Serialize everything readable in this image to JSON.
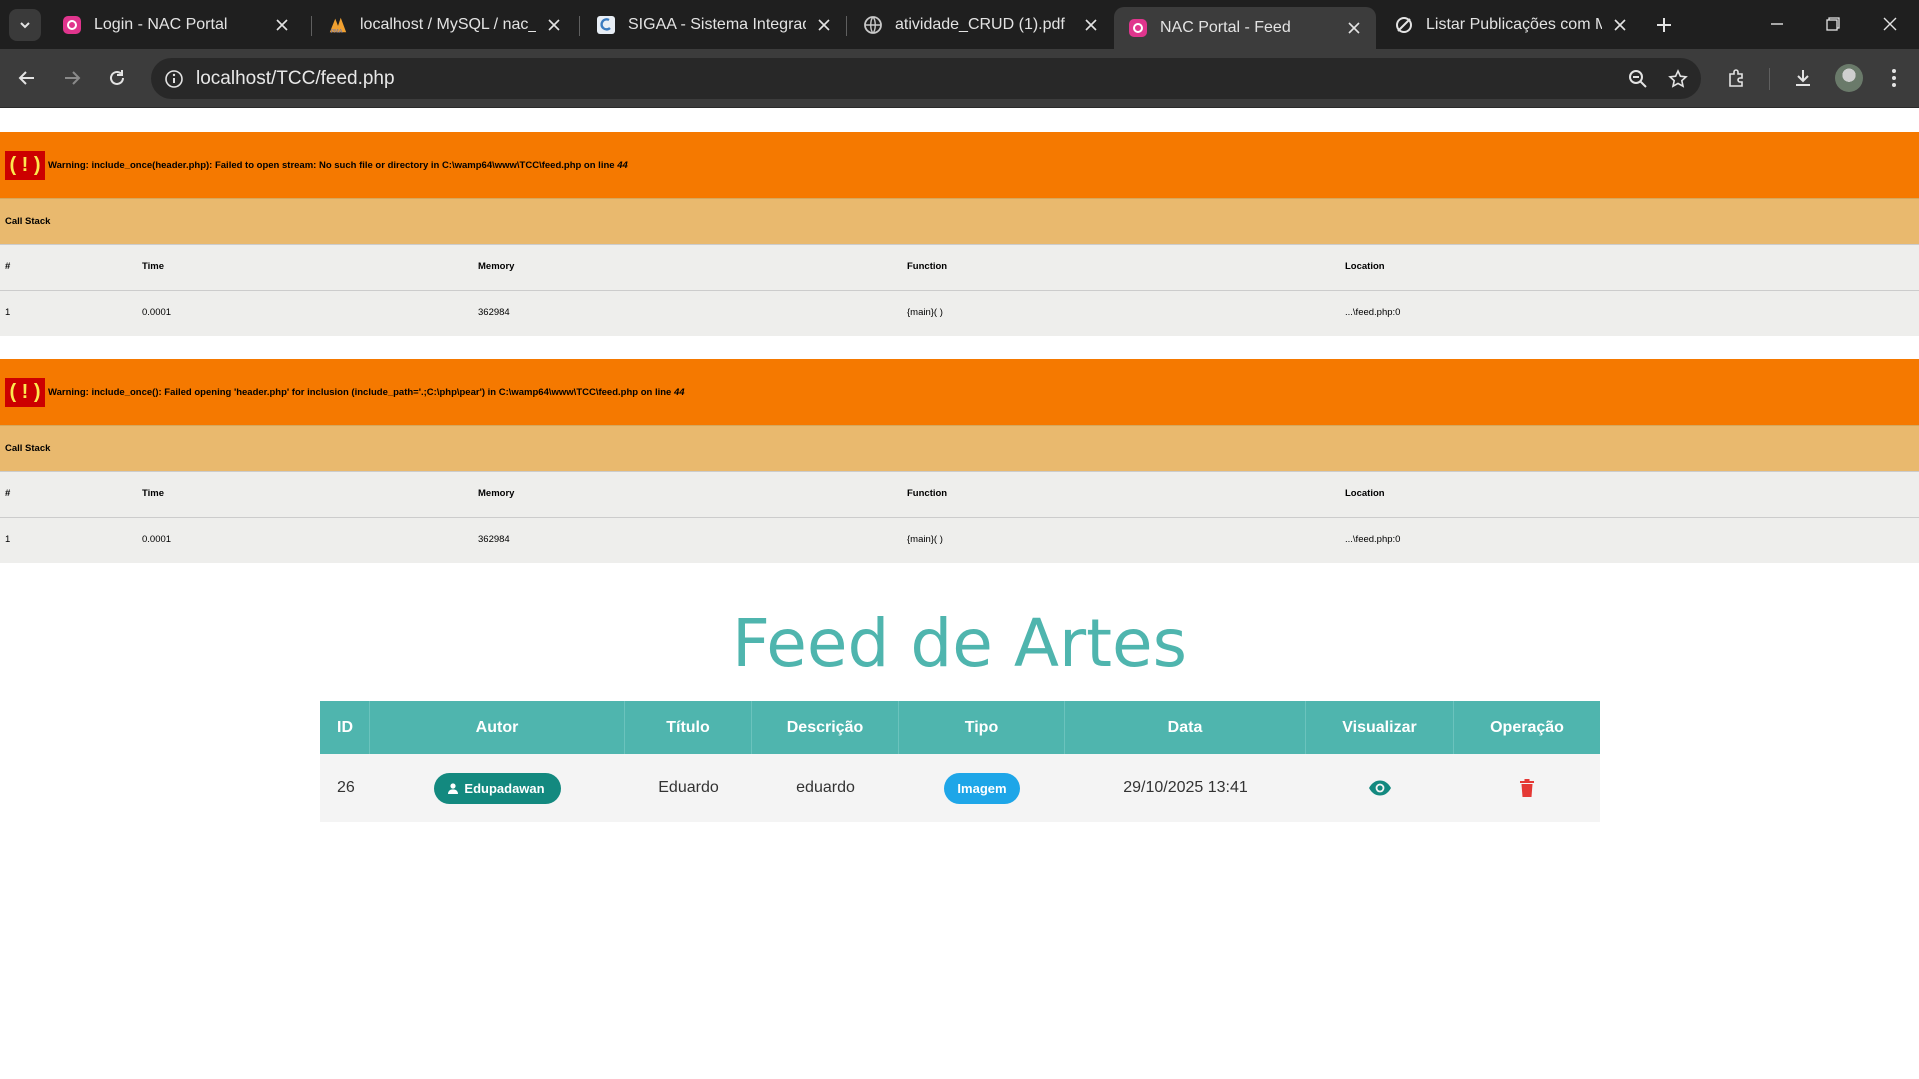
{
  "browser": {
    "tabs": [
      {
        "title": "Login - NAC Portal",
        "active": false
      },
      {
        "title": "localhost / MySQL / nac_p",
        "active": false
      },
      {
        "title": "SIGAA - Sistema Integrado",
        "active": false
      },
      {
        "title": "atividade_CRUD (1).pdf",
        "active": false
      },
      {
        "title": "NAC Portal - Feed",
        "active": true
      },
      {
        "title": "Listar Publicações com Ma",
        "active": false
      }
    ],
    "url": "localhost/TCC/feed.php"
  },
  "warnings": [
    {
      "badge": "( ! )",
      "message": "Warning: include_once(header.php): Failed to open stream: No such file or directory in C:\\wamp64\\www\\TCC\\feed.php on line ",
      "line": "44",
      "call_stack_label": "Call Stack",
      "headers": [
        "#",
        "Time",
        "Memory",
        "Function",
        "Location"
      ],
      "row": [
        "1",
        "0.0001",
        "362984",
        "{main}( )",
        "...\\feed.php:0"
      ]
    },
    {
      "badge": "( ! )",
      "message": "Warning: include_once(): Failed opening 'header.php' for inclusion (include_path='.;C:\\php\\pear') in C:\\wamp64\\www\\TCC\\feed.php on line ",
      "line": "44",
      "call_stack_label": "Call Stack",
      "headers": [
        "#",
        "Time",
        "Memory",
        "Function",
        "Location"
      ],
      "row": [
        "1",
        "0.0001",
        "362984",
        "{main}( )",
        "...\\feed.php:0"
      ]
    }
  ],
  "feed": {
    "title": "Feed de Artes",
    "columns": [
      "ID",
      "Autor",
      "Título",
      "Descrição",
      "Tipo",
      "Data",
      "Visualizar",
      "Operação"
    ],
    "rows": [
      {
        "id": "26",
        "author": "Edupadawan",
        "title": "Eduardo",
        "description": "eduardo",
        "type": "Imagem",
        "date": "29/10/2025 13:41"
      }
    ]
  },
  "colors": {
    "accent": "#4fb5ae",
    "author_pill": "#13897f",
    "type_pill": "#1ea6e8",
    "eye_icon": "#13897f",
    "delete_icon": "#e53935",
    "warning_bg": "#f57900",
    "callstack_bg": "#e9b96e"
  },
  "icons": {
    "view": "eye-icon",
    "delete": "trash-icon",
    "author": "user-icon"
  }
}
